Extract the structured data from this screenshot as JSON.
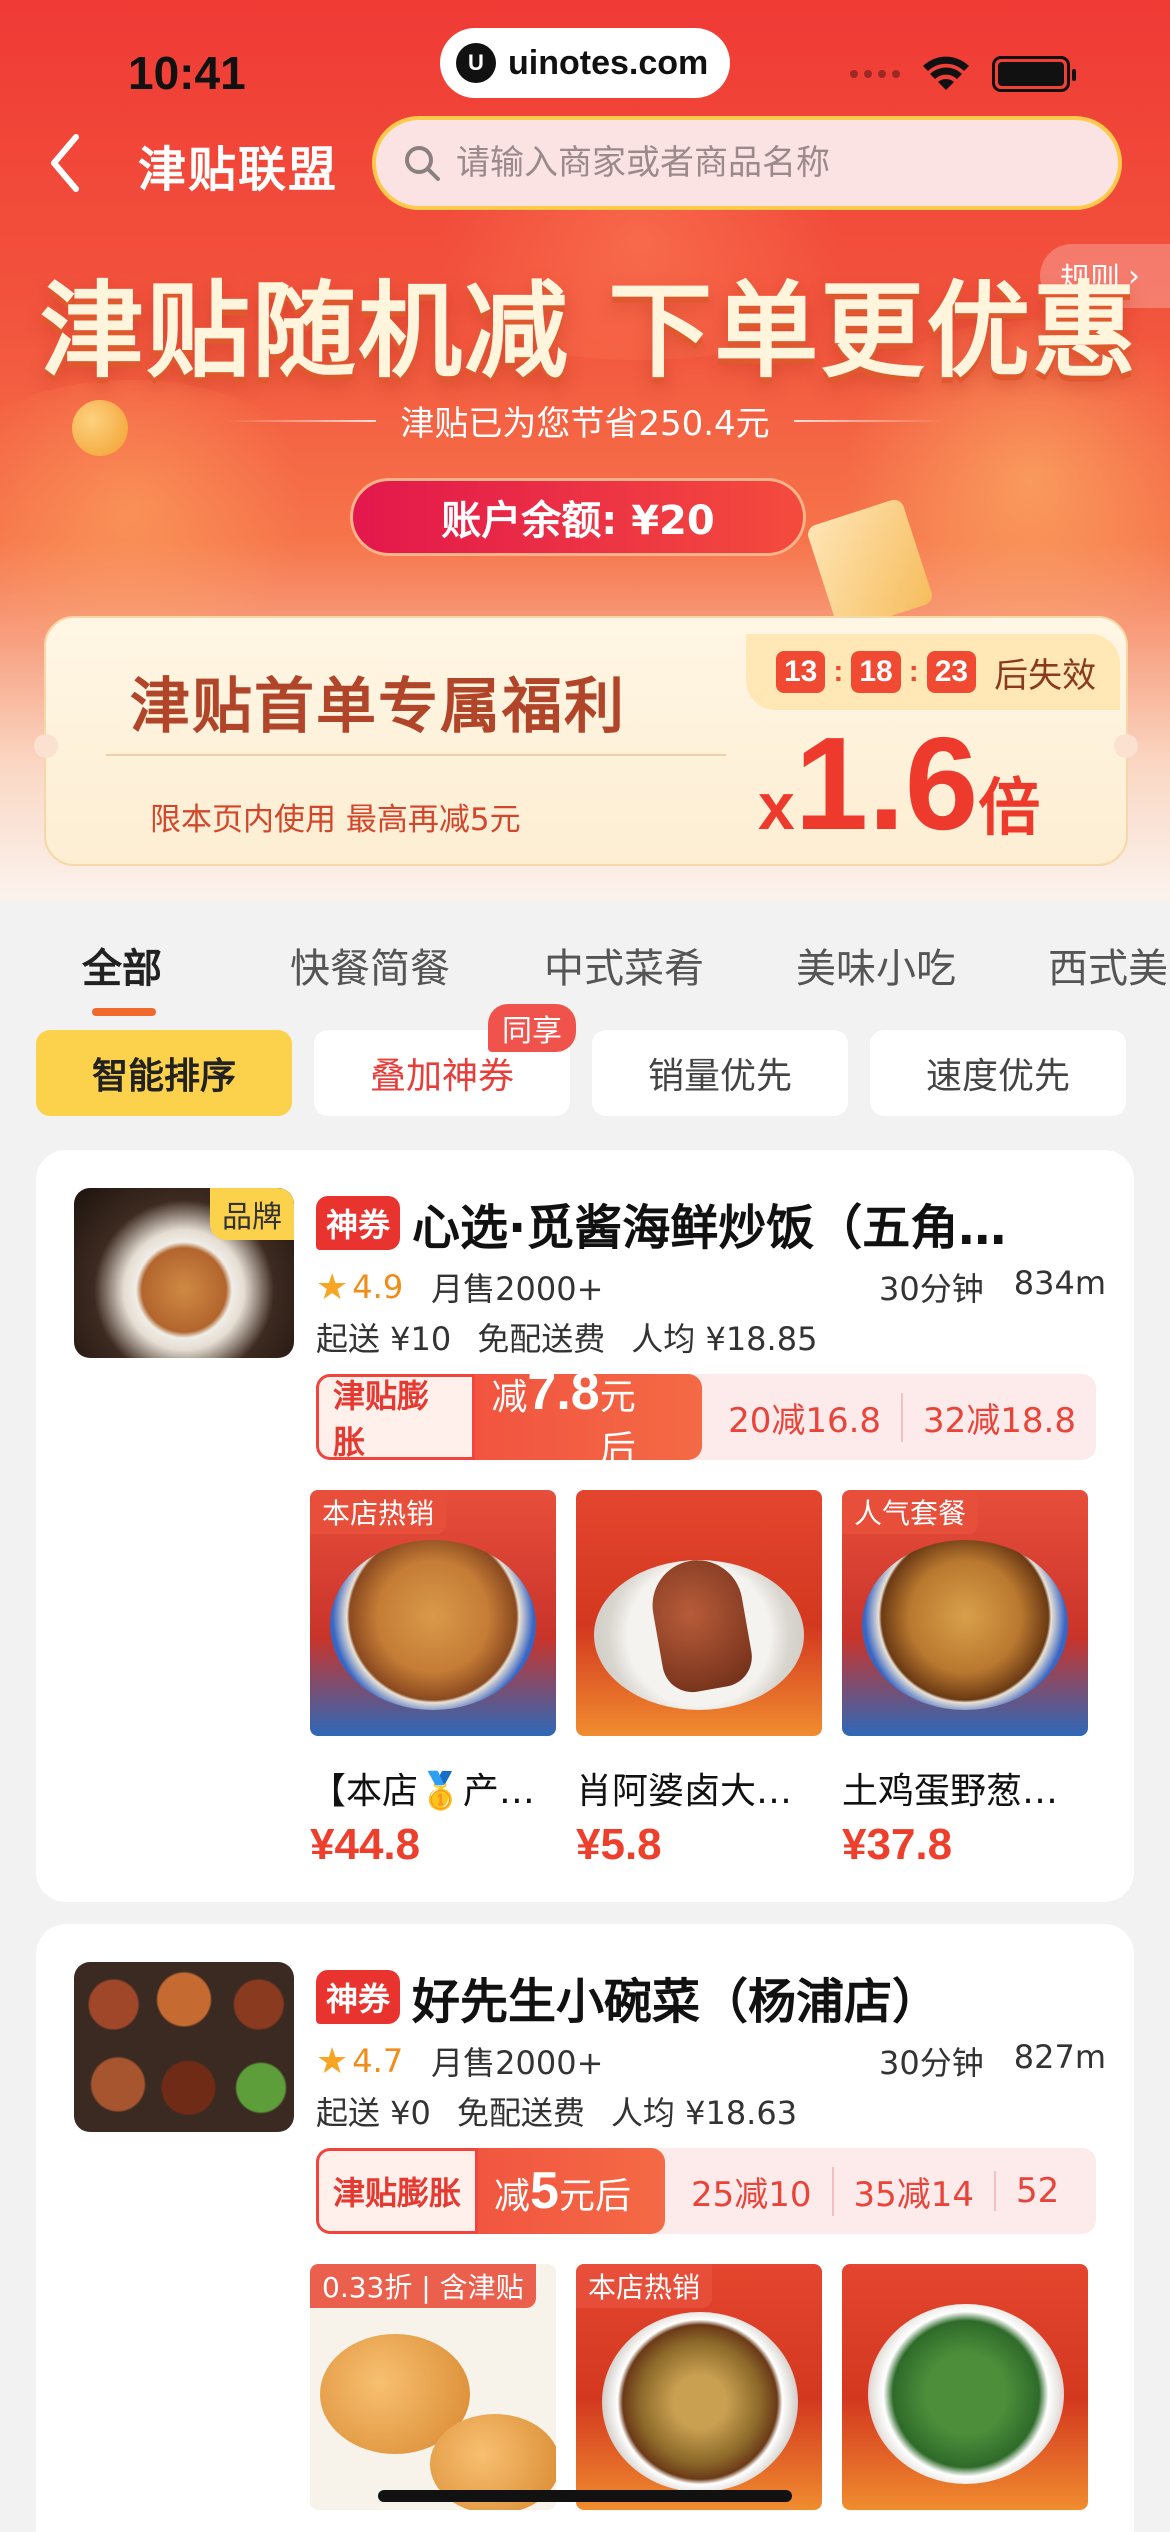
{
  "status_bar": {
    "time": "10:41",
    "url": "uinotes.com"
  },
  "nav": {
    "title": "津贴联盟",
    "search_placeholder": "请输入商家或者商品名称",
    "rules_label": "规则"
  },
  "hero": {
    "headline": "津贴随机减 下单更优惠",
    "saved_text": "津贴已为您节省250.4元",
    "balance_text": "账户余额: ¥20"
  },
  "welfare": {
    "title": "津贴首单专属福利",
    "note": "限本页内使用   最高再减5元",
    "timer": [
      "13",
      "18",
      "23"
    ],
    "timer_suffix": "后失效",
    "multiplier_prefix": "x",
    "multiplier_value": "1.6",
    "multiplier_unit": "倍"
  },
  "categories": [
    {
      "label": "全部",
      "active": true
    },
    {
      "label": "快餐简餐"
    },
    {
      "label": "中式菜肴"
    },
    {
      "label": "美味小吃"
    },
    {
      "label": "西式美"
    }
  ],
  "sort_options": [
    {
      "label": "智能排序",
      "active": true
    },
    {
      "label": "叠加神券",
      "badge": "同享"
    },
    {
      "label": "销量优先"
    },
    {
      "label": "速度优先"
    }
  ],
  "stores": [
    {
      "brand_tag": "品牌",
      "coupon_tag": "神券",
      "name": "心选·觅酱海鲜炒饭（五角…",
      "rating": "4.9",
      "monthly_sales": "月售2000+",
      "delivery_time": "30分钟",
      "distance": "834m",
      "min_order": "起送 ¥10",
      "delivery_fee": "免配送费",
      "avg_price": "人均 ¥18.85",
      "promo_label": "津贴膨胀",
      "promo_prefix": "减",
      "promo_amount": "7.8",
      "promo_suffix": "元后",
      "promo_tiers": [
        "20减16.8",
        "32减18.8"
      ],
      "items": [
        {
          "badge": "本店热销",
          "name": "【本店🥇产…",
          "price": "¥44.8"
        },
        {
          "badge": "",
          "name": "肖阿婆卤大…",
          "price": "¥5.8"
        },
        {
          "badge": "人气套餐",
          "name": "土鸡蛋野葱…",
          "price": "¥37.8"
        }
      ]
    },
    {
      "brand_tag": "",
      "coupon_tag": "神券",
      "name": "好先生小碗菜（杨浦店）",
      "rating": "4.7",
      "monthly_sales": "月售2000+",
      "delivery_time": "30分钟",
      "distance": "827m",
      "min_order": "起送 ¥0",
      "delivery_fee": "免配送费",
      "avg_price": "人均 ¥18.63",
      "promo_label": "津贴膨胀",
      "promo_prefix": "减",
      "promo_amount": "5",
      "promo_suffix": "元后",
      "promo_tiers": [
        "25减10",
        "35减14",
        "52"
      ],
      "items": [
        {
          "badge": "0.33折 | 含津贴",
          "name": "",
          "price": ""
        },
        {
          "badge": "本店热销",
          "name": "",
          "price": ""
        },
        {
          "badge": "",
          "name": "",
          "price": ""
        }
      ]
    }
  ],
  "colors": {
    "accent_red": "#ee3f2c",
    "accent_yellow": "#fcd24d",
    "hero_red": "#f03a35"
  }
}
